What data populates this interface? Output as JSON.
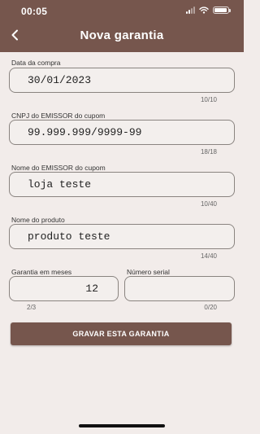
{
  "status_bar": {
    "time": "00:05"
  },
  "header": {
    "title": "Nova garantia"
  },
  "icons": {
    "back": "chevron-left-icon",
    "signal": "signal-icon",
    "wifi": "wifi-icon",
    "battery": "battery-icon"
  },
  "form": {
    "purchase_date": {
      "label": "Data da compra",
      "value": "30/01/2023",
      "counter": "10/10"
    },
    "cnpj": {
      "label": "CNPJ do EMISSOR do cupom",
      "value": "99.999.999/9999-99",
      "counter": "18/18"
    },
    "issuer_name": {
      "label": "Nome do EMISSOR do cupom",
      "value": "loja teste",
      "counter": "10/40"
    },
    "product_name": {
      "label": "Nome do produto",
      "value": "produto teste",
      "counter": "14/40"
    },
    "warranty_months": {
      "label": "Garantia em meses",
      "value": "12",
      "counter": "2/3"
    },
    "serial_number": {
      "label": "Número serial",
      "value": "",
      "counter": "0/20"
    }
  },
  "actions": {
    "save_label": "GRAVAR ESTA GARANTIA"
  },
  "colors": {
    "brand": "#76564d",
    "background": "#f2ecea"
  }
}
